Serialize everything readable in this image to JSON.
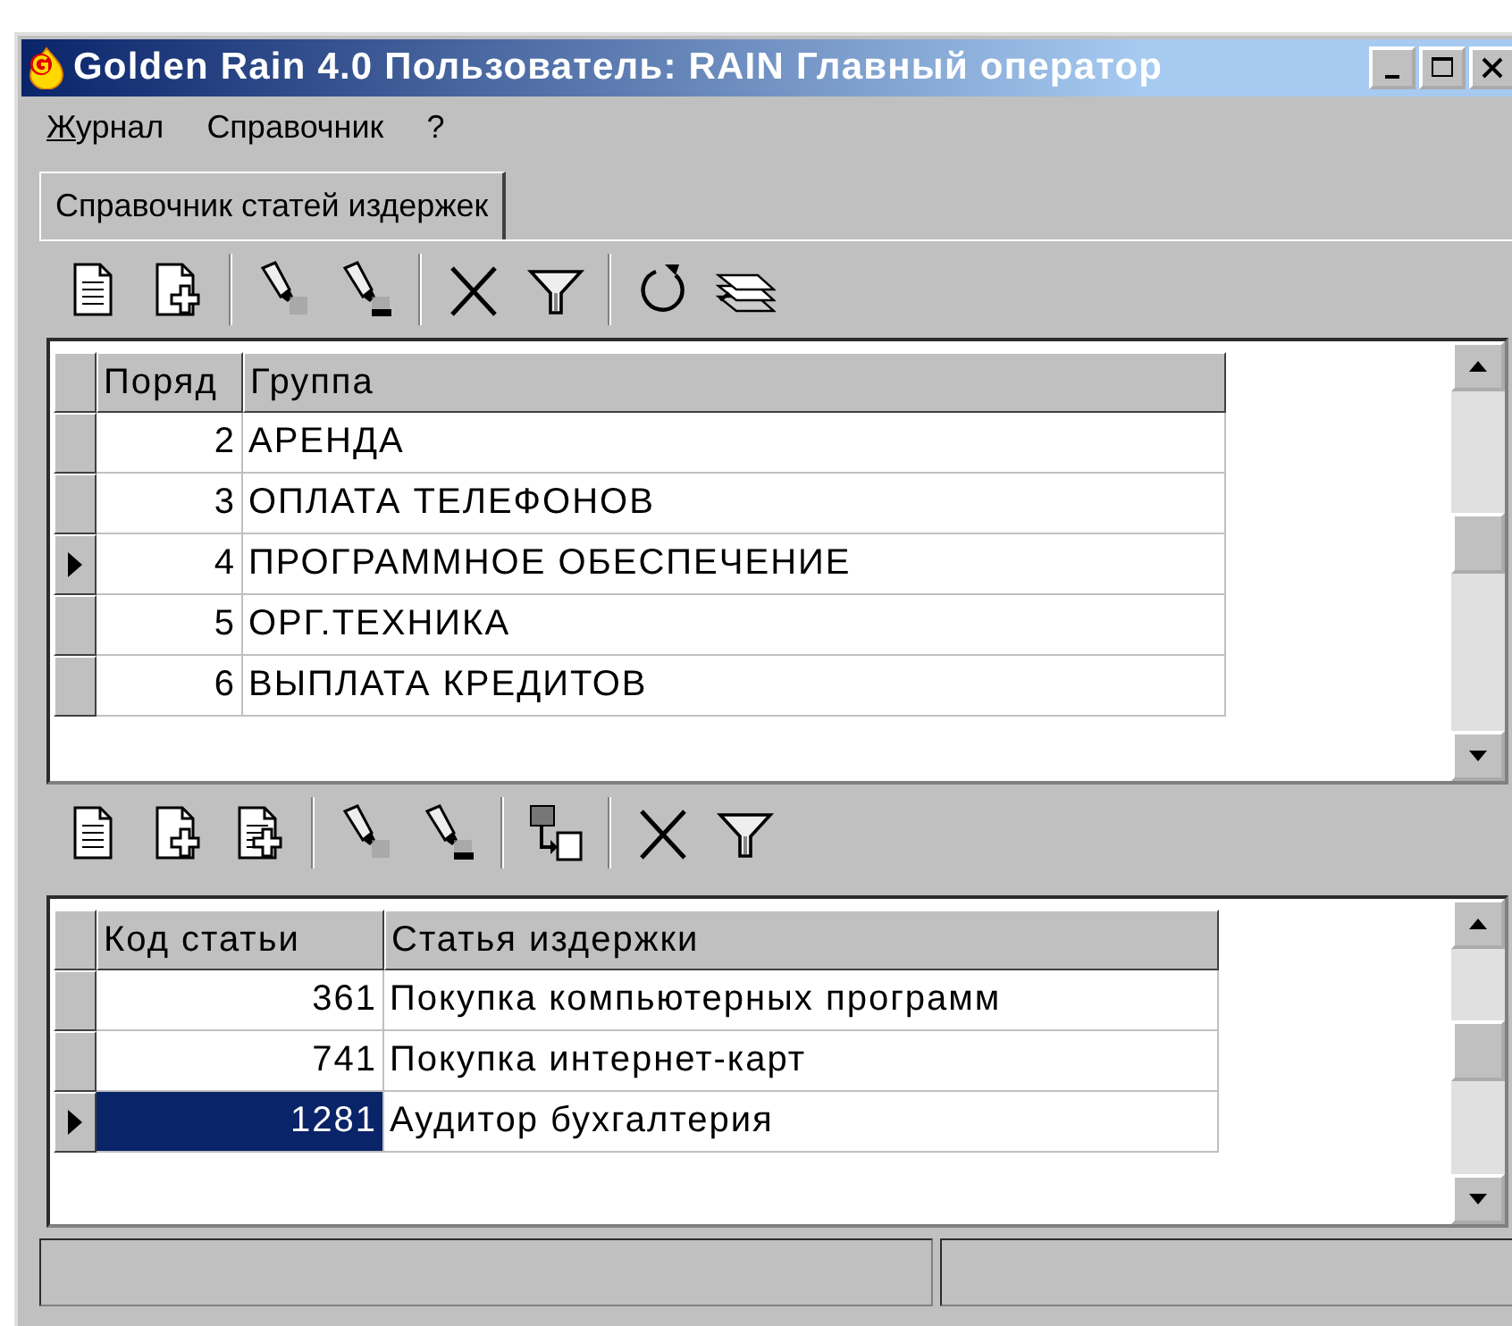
{
  "window": {
    "title": "Golden Rain 4.0 Пользователь: RAIN Главный оператор"
  },
  "menu": [
    {
      "label": "Журнал",
      "underline_first": true
    },
    {
      "label": "Справочник",
      "underline_first": false
    },
    {
      "label": "?",
      "underline_first": false
    }
  ],
  "tabs": [
    {
      "label": "Справочник статей издержек",
      "selected": true
    }
  ],
  "groups_table": {
    "columns": [
      "Поряд",
      "Группа"
    ],
    "rows": [
      {
        "cells": [
          "2",
          "АРЕНДА"
        ],
        "selected": false
      },
      {
        "cells": [
          "3",
          "ОПЛАТА ТЕЛЕФОНОВ"
        ],
        "selected": false
      },
      {
        "cells": [
          "4",
          "ПРОГРАММНОЕ ОБЕСПЕЧЕНИЕ"
        ],
        "selected": true
      },
      {
        "cells": [
          "5",
          "ОРГ.ТЕХНИКА"
        ],
        "selected": false
      },
      {
        "cells": [
          "6",
          "ВЫПЛАТА КРЕДИТОВ"
        ],
        "selected": false
      }
    ]
  },
  "items_table": {
    "columns": [
      "Код статьи",
      "Статья издержки"
    ],
    "rows": [
      {
        "cells": [
          "361",
          "Покупка компьютерных программ"
        ],
        "selected": false
      },
      {
        "cells": [
          "741",
          "Покупка интернет-карт"
        ],
        "selected": false
      },
      {
        "cells": [
          "1281",
          "Аудитор  бухгалтерия"
        ],
        "selected": true
      }
    ]
  }
}
